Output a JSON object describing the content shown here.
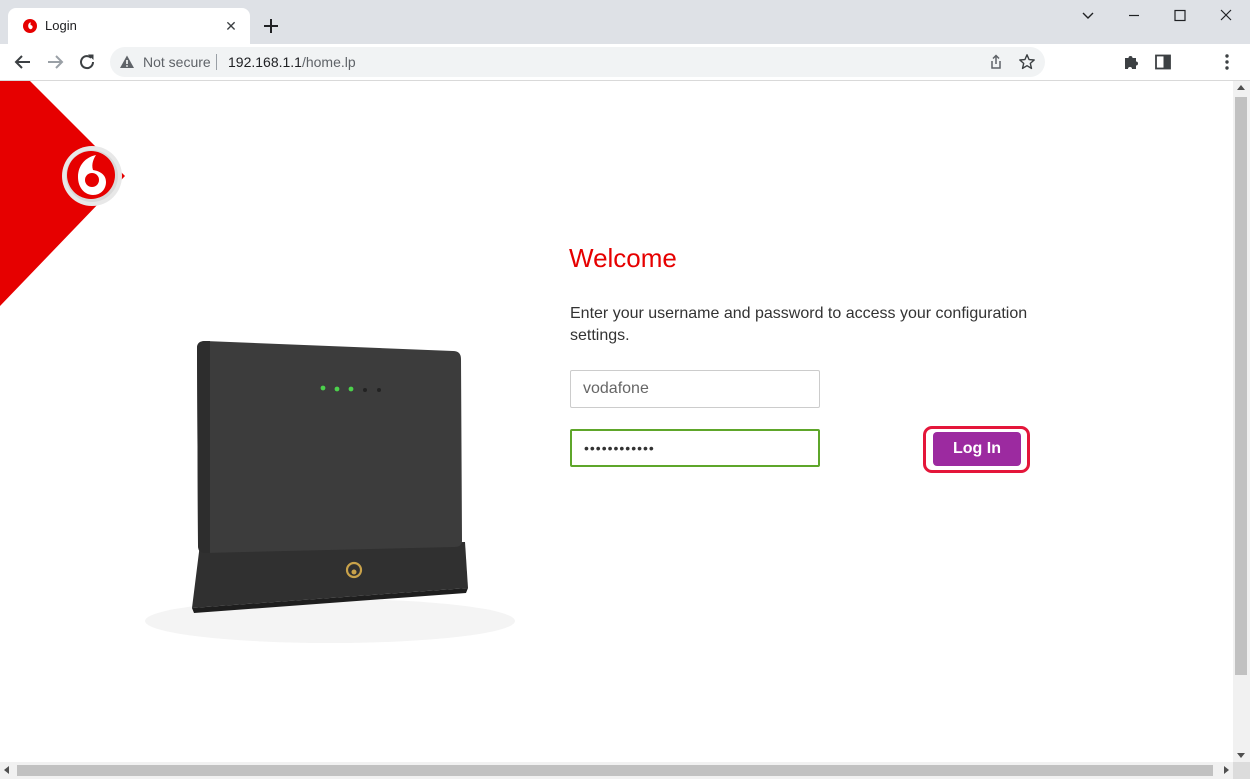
{
  "browser": {
    "tab_title": "Login",
    "tab_close": "✕",
    "address": {
      "security_label": "Not secure",
      "host": "192.168.1.1",
      "path": "/home.lp"
    }
  },
  "page": {
    "welcome_title": "Welcome",
    "instructions": "Enter your username and password to access your configuration settings.",
    "username_value": "vodafone",
    "password_masked": "••••••••••••",
    "login_label": "Log In"
  },
  "colors": {
    "brand_red": "#e60000",
    "button_purple": "#9c2aa0",
    "focus_green": "#5ea62a",
    "highlight_ring": "#e4163a"
  }
}
